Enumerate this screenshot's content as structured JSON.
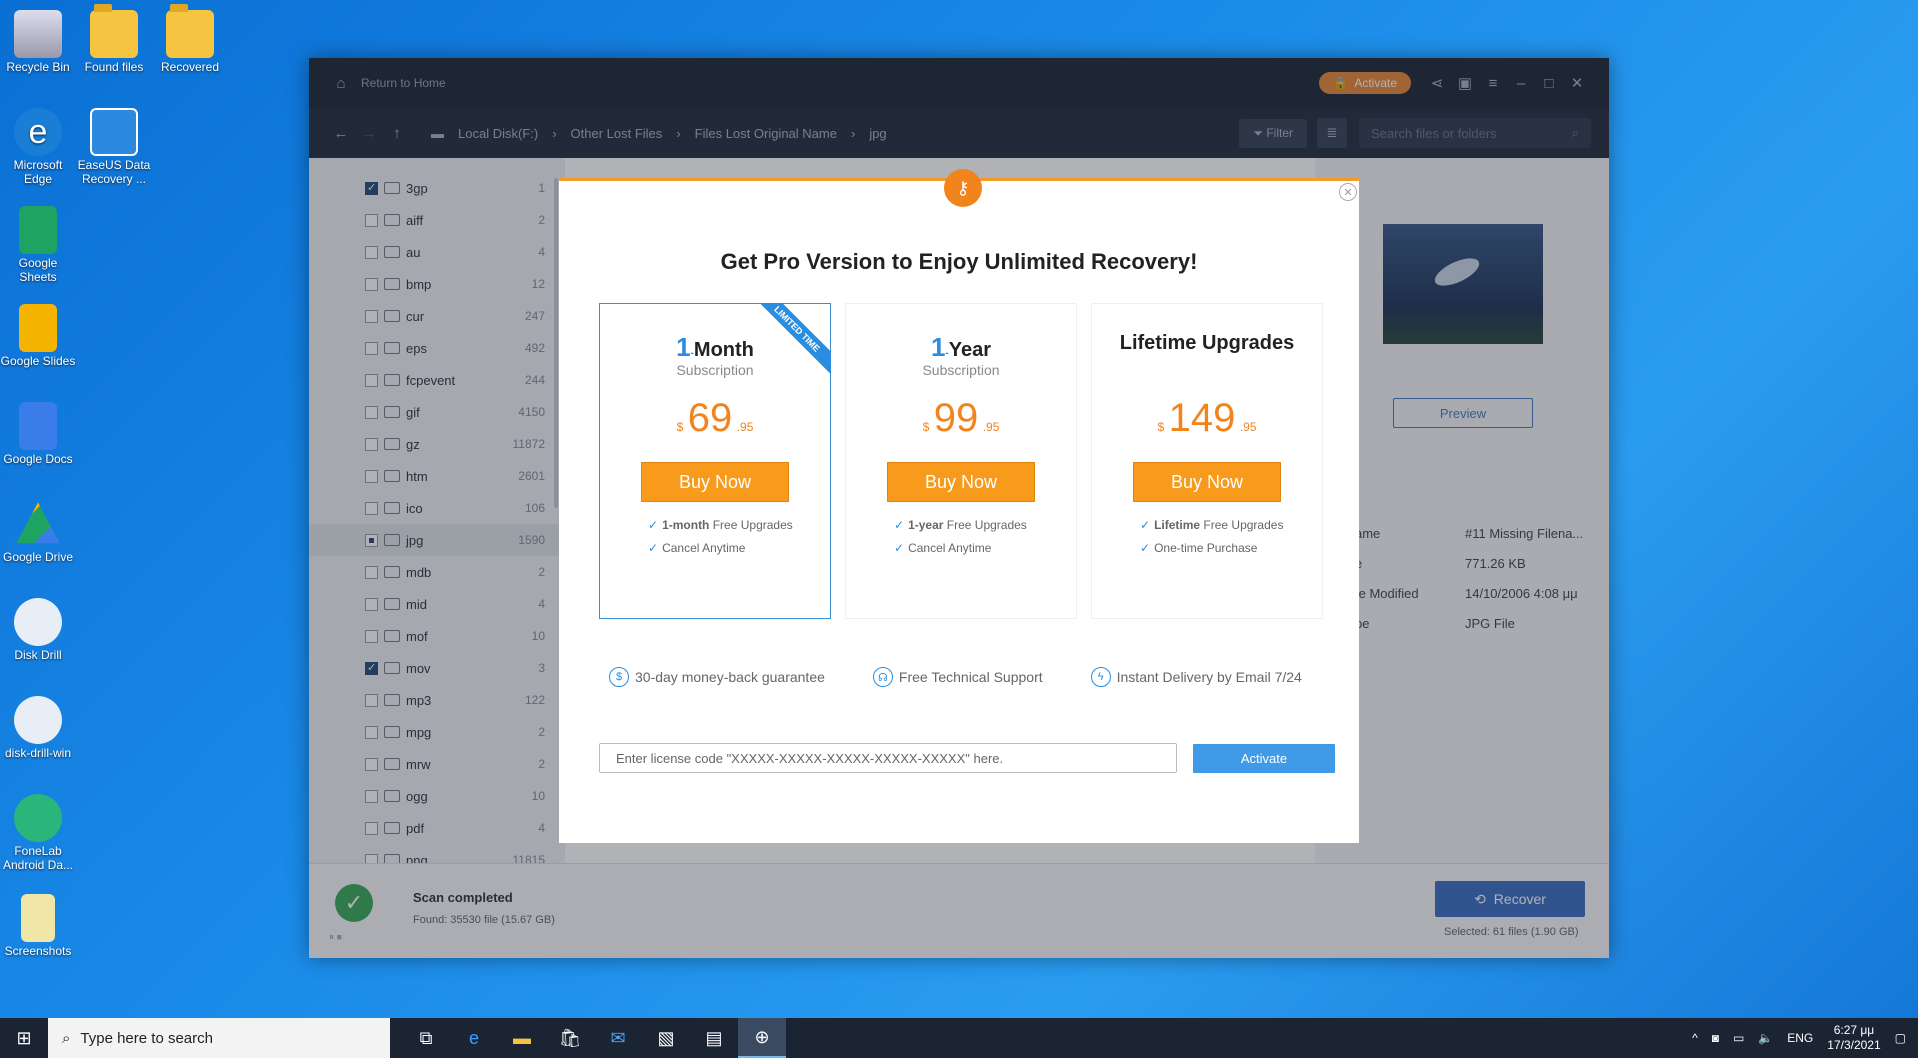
{
  "desktop": {
    "icons": [
      {
        "label": "Recycle Bin",
        "name": "recycle-bin-icon"
      },
      {
        "label": "Found files",
        "name": "folder-icon"
      },
      {
        "label": "Recovered",
        "name": "folder-icon"
      },
      {
        "label": "Microsoft Edge",
        "name": "edge-icon"
      },
      {
        "label": "EaseUS Data Recovery ...",
        "name": "easeus-icon"
      },
      {
        "label": "Google Sheets",
        "name": "sheets-icon"
      },
      {
        "label": "Google Slides",
        "name": "slides-icon"
      },
      {
        "label": "Google Docs",
        "name": "docs-icon"
      },
      {
        "label": "Google Drive",
        "name": "drive-icon"
      },
      {
        "label": "Disk Drill",
        "name": "diskdrill-icon"
      },
      {
        "label": "disk-drill-win",
        "name": "diskdrill-icon"
      },
      {
        "label": "FoneLab Android Da...",
        "name": "fonelab-icon"
      },
      {
        "label": "Screenshots",
        "name": "screenshots-icon"
      }
    ]
  },
  "window": {
    "return_home": "Return to Home",
    "activate_label": "Activate",
    "breadcrumb": [
      "Local Disk(F:)",
      "Other Lost Files",
      "Files Lost Original Name",
      "jpg"
    ],
    "filter_label": "Filter",
    "search_placeholder": "Search files or folders",
    "file_types": [
      {
        "name": "3gp",
        "count": "1",
        "state": "on"
      },
      {
        "name": "aiff",
        "count": "2",
        "state": "off"
      },
      {
        "name": "au",
        "count": "4",
        "state": "off"
      },
      {
        "name": "bmp",
        "count": "12",
        "state": "off"
      },
      {
        "name": "cur",
        "count": "247",
        "state": "off"
      },
      {
        "name": "eps",
        "count": "492",
        "state": "off"
      },
      {
        "name": "fcpevent",
        "count": "244",
        "state": "off"
      },
      {
        "name": "gif",
        "count": "4150",
        "state": "off"
      },
      {
        "name": "gz",
        "count": "11872",
        "state": "off"
      },
      {
        "name": "htm",
        "count": "2601",
        "state": "off"
      },
      {
        "name": "ico",
        "count": "106",
        "state": "off"
      },
      {
        "name": "jpg",
        "count": "1590",
        "state": "part"
      },
      {
        "name": "mdb",
        "count": "2",
        "state": "off"
      },
      {
        "name": "mid",
        "count": "4",
        "state": "off"
      },
      {
        "name": "mof",
        "count": "10",
        "state": "off"
      },
      {
        "name": "mov",
        "count": "3",
        "state": "on"
      },
      {
        "name": "mp3",
        "count": "122",
        "state": "off"
      },
      {
        "name": "mpg",
        "count": "2",
        "state": "off"
      },
      {
        "name": "mrw",
        "count": "2",
        "state": "off"
      },
      {
        "name": "ogg",
        "count": "10",
        "state": "off"
      },
      {
        "name": "pdf",
        "count": "4",
        "state": "off"
      },
      {
        "name": "png",
        "count": "11815",
        "state": "off"
      }
    ],
    "preview_label": "Preview",
    "properties": [
      {
        "k": "ame",
        "v": "#11 Missing Filena..."
      },
      {
        "k": "e",
        "v": "771.26 KB"
      },
      {
        "k": "te Modified",
        "v": "14/10/2006 4:08 μμ"
      },
      {
        "k": "pe",
        "v": "JPG File"
      }
    ],
    "scan_status": "Scan completed",
    "scan_found": "Found: 35530 file (15.67 GB)",
    "recover_label": "Recover",
    "selected_info": "Selected: 61 files (1.90 GB)"
  },
  "modal": {
    "title": "Get Pro Version to Enjoy Unlimited Recovery!",
    "plans": [
      {
        "num": "1",
        "unit": "Month",
        "sub": "Subscription",
        "cur": "$",
        "price": "69",
        "dec": ".95",
        "buy": "Buy Now",
        "feat1_b": "1-month",
        "feat1": " Free Upgrades",
        "feat2": "Cancel Anytime",
        "ribbon": "LIMITED TIME"
      },
      {
        "num": "1",
        "unit": "Year",
        "sub": "Subscription",
        "cur": "$",
        "price": "99",
        "dec": ".95",
        "buy": "Buy Now",
        "feat1_b": "1-year",
        "feat1": " Free Upgrades",
        "feat2": "Cancel Anytime"
      },
      {
        "title": "Lifetime Upgrades",
        "cur": "$",
        "price": "149",
        "dec": ".95",
        "buy": "Buy Now",
        "feat1_b": "Lifetime",
        "feat1": " Free Upgrades",
        "feat2": "One-time Purchase"
      }
    ],
    "guarantees": [
      "30-day money-back guarantee",
      "Free Technical Support",
      "Instant Delivery by Email 7/24"
    ],
    "license_placeholder": "Enter license code \"XXXXX-XXXXX-XXXXX-XXXXX-XXXXX\" here.",
    "activate_label": "Activate"
  },
  "taskbar": {
    "search_placeholder": "Type here to search",
    "lang": "ENG",
    "time": "6:27 μμ",
    "date": "17/3/2021"
  }
}
